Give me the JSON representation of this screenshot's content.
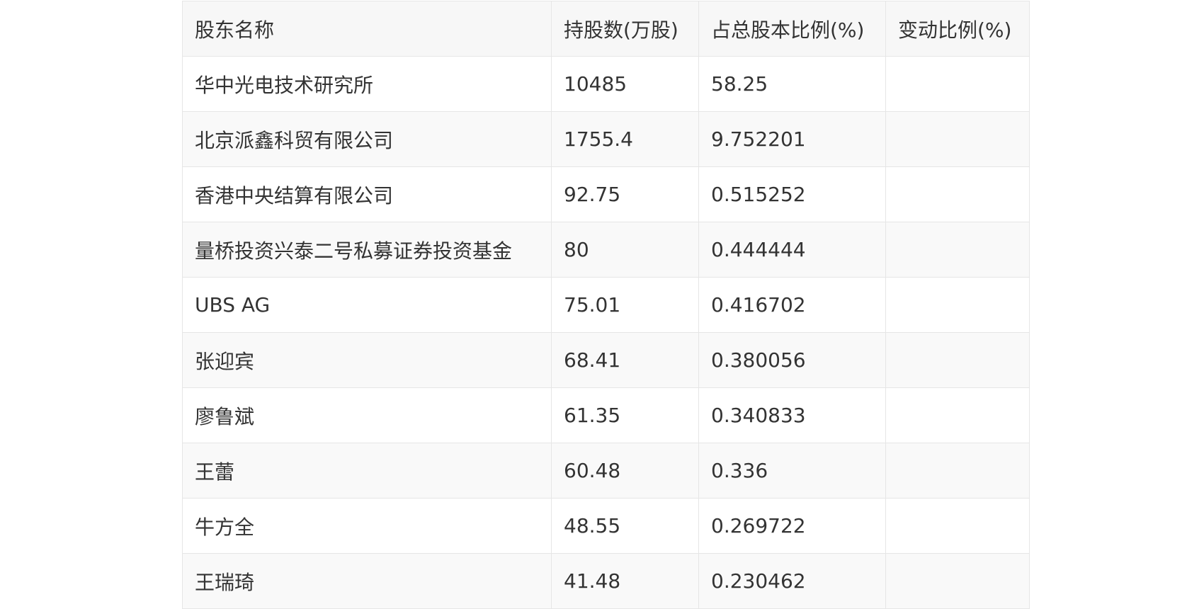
{
  "table": {
    "headers": [
      "股东名称",
      "持股数(万股)",
      "占总股本比例(%)",
      "变动比例(%)"
    ],
    "rows": [
      [
        "华中光电技术研究所",
        "10485",
        "58.25",
        ""
      ],
      [
        "北京派鑫科贸有限公司",
        "1755.4",
        "9.752201",
        ""
      ],
      [
        "香港中央结算有限公司",
        "92.75",
        "0.515252",
        ""
      ],
      [
        "量桥投资兴泰二号私募证券投资基金",
        "80",
        "0.444444",
        ""
      ],
      [
        "UBS AG",
        "75.01",
        "0.416702",
        ""
      ],
      [
        "张迎宾",
        "68.41",
        "0.380056",
        ""
      ],
      [
        "廖鲁斌",
        "61.35",
        "0.340833",
        ""
      ],
      [
        "王蕾",
        "60.48",
        "0.336",
        ""
      ],
      [
        "牛方全",
        "48.55",
        "0.269722",
        ""
      ],
      [
        "王瑞琦",
        "41.48",
        "0.230462",
        ""
      ]
    ]
  }
}
